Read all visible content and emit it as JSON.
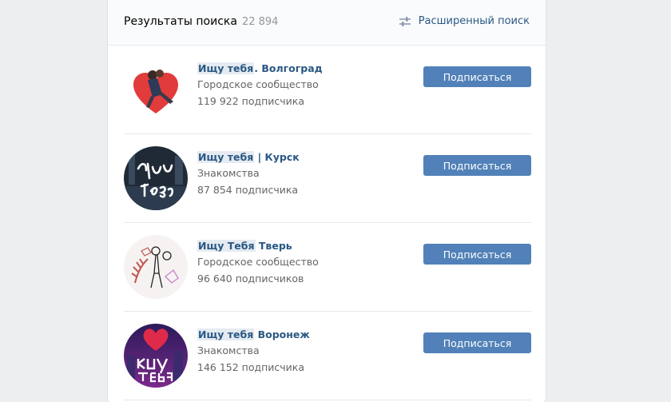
{
  "header": {
    "title": "Результаты поиска",
    "count": "22 894",
    "advanced_search_label": "Расширенный поиск",
    "advanced_search_icon": "sliders-icon"
  },
  "results": [
    {
      "name_highlight": "Ищу тебя",
      "name_rest": ". Волгоград",
      "category": "Городское сообщество",
      "subscribers": "119 922 подписчика",
      "button_label": "Подписаться"
    },
    {
      "name_highlight": "Ищу тебя",
      "name_rest": " | Курск",
      "category": "Знакомства",
      "subscribers": "87 854 подписчика",
      "button_label": "Подписаться"
    },
    {
      "name_highlight": "Ищу Тебя",
      "name_rest": " Тверь",
      "category": "Городское сообщество",
      "subscribers": "96 640 подписчиков",
      "button_label": "Подписаться"
    },
    {
      "name_highlight": "Ищу тебя",
      "name_rest": " Воронеж",
      "category": "Знакомства",
      "subscribers": "146 152 подписчика",
      "button_label": "Подписаться"
    }
  ],
  "colors": {
    "accent": "#5181b8",
    "link": "#2a5885",
    "muted": "#656565"
  }
}
